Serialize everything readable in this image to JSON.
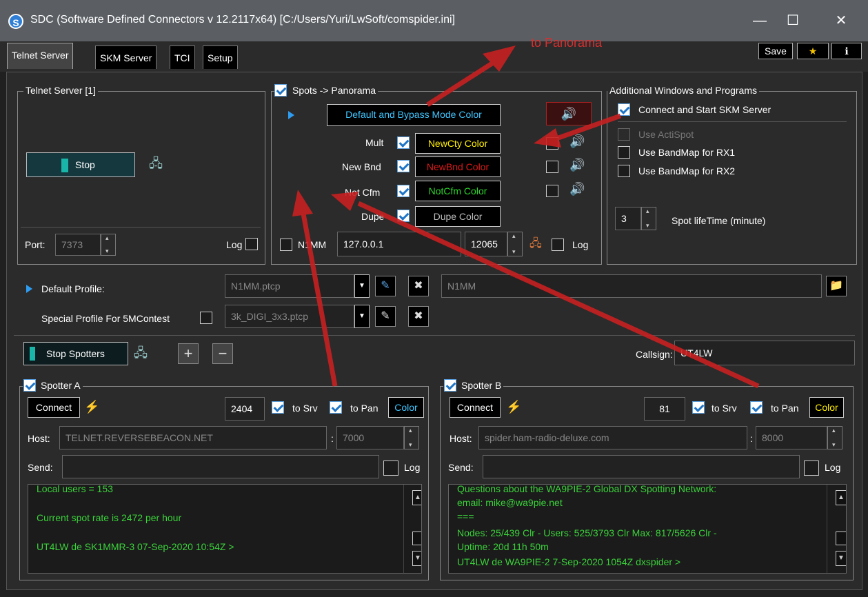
{
  "window": {
    "app_icon": "S",
    "title": "SDC (Software Defined Connectors v 12.2117x64) [C:/Users/Yuri/LwSoft/comspider.ini]",
    "min": "—",
    "max": "☐",
    "close": "✕"
  },
  "tabs": [
    "Telnet Server",
    "SKM Server",
    "TCI",
    "Setup"
  ],
  "toolbar": {
    "save": "Save",
    "star": "★",
    "help": "ℹ"
  },
  "annotation": {
    "text": "to Panorama",
    "color": "#d63030"
  },
  "telnet_server": {
    "title": "Telnet Server [1]",
    "stop": "Stop",
    "port_label": "Port:",
    "port": "7373",
    "log": "Log"
  },
  "spots": {
    "title": "Spots -> Panorama",
    "default_color": "Default and Bypass Mode Color",
    "rows": [
      {
        "label": "Mult",
        "color_label": "NewCty Color",
        "color": "#ffee00"
      },
      {
        "label": "New Bnd",
        "color_label": "NewBnd Color",
        "color": "#e01818"
      },
      {
        "label": "Not Cfm",
        "color_label": "NotCfm Color",
        "color": "#2ad82a"
      },
      {
        "label": "Dupe",
        "color_label": "Dupe Color",
        "color": "#bbbbbb"
      }
    ],
    "n1mm": "N1MM",
    "ip": "127.0.0.1",
    "port": "12065",
    "log": "Log"
  },
  "additional": {
    "title": "Additional Windows and Programs",
    "connect_skm": "Connect and Start SKM Server",
    "use_actispot": "Use ActiSpot",
    "bandmap_rx1": "Use BandMap for RX1",
    "bandmap_rx2": "Use BandMap for RX2",
    "lifetime_value": "3",
    "lifetime_label": "Spot lifeTime (minute)"
  },
  "profile": {
    "default_label": "Default Profile:",
    "default_file": "N1MM.ptcp",
    "default_name": "N1MM",
    "special_label": "Special Profile For 5MContest",
    "special_file": "3k_DIGI_3x3.ptcp"
  },
  "spotters_bar": {
    "stop": "Stop Spotters",
    "add": "+",
    "remove": "−",
    "callsign_label": "Callsign:",
    "callsign": "UT4LW"
  },
  "spotter_a": {
    "title": "Spotter A",
    "connect": "Connect",
    "number": "2404",
    "to_srv": "to Srv",
    "to_pan": "to Pan",
    "color": "Color",
    "color_value": "#3fc6ff",
    "host_label": "Host:",
    "host": "TELNET.REVERSEBEACON.NET",
    "colon": ":",
    "port": "7000",
    "send_label": "Send:",
    "log": "Log",
    "console": [
      "Local users =  153",
      "",
      "Current spot rate is 2472 per hour",
      "",
      "UT4LW de SK1MMR-3  07-Sep-2020 10:54Z >"
    ]
  },
  "spotter_b": {
    "title": "Spotter B",
    "connect": "Connect",
    "number": "81",
    "to_srv": "to Srv",
    "to_pan": "to Pan",
    "color": "Color",
    "color_value": "#ffee00",
    "host_label": "Host:",
    "host": "spider.ham-radio-deluxe.com",
    "colon": ":",
    "port": "8000",
    "send_label": "Send:",
    "log": "Log",
    "console": [
      "Questions about the WA9PIE-2 Global DX Spotting Network:",
      "email: mike@wa9pie.net",
      "===",
      "Nodes: 25/439 Clr - Users: 525/3793 Clr Max: 817/5626 Clr -",
      "Uptime:  20d 11h 50m",
      "UT4LW de WA9PIE-2  7-Sep-2020 1054Z dxspider >"
    ]
  }
}
